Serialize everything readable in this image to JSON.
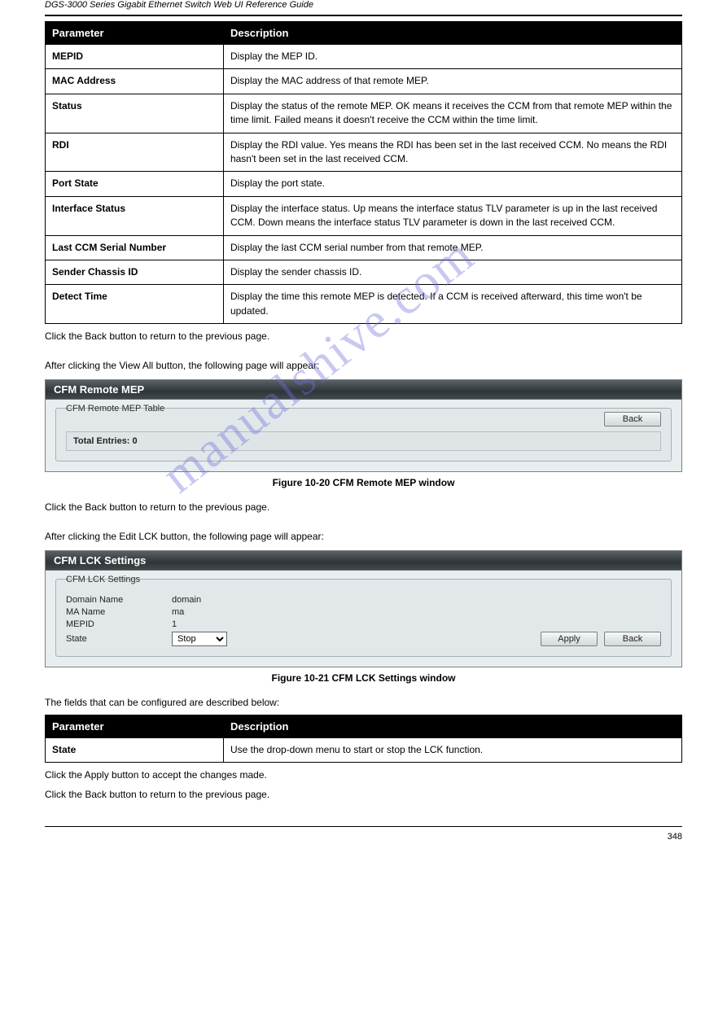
{
  "header": {
    "left": "DGS-3000 Series Gigabit Ethernet Switch Web UI Reference Guide",
    "right": ""
  },
  "watermark": "manualshive.com",
  "table1": {
    "headers": [
      "Parameter",
      "Description"
    ],
    "rows": [
      {
        "k": "MEPID",
        "v": "Display the MEP ID."
      },
      {
        "k": "MAC Address",
        "v": "Display the MAC address of that remote MEP."
      },
      {
        "k": "Status",
        "v": "Display the status of the remote MEP. OK means it receives the CCM from that remote MEP within the time limit. Failed means it doesn't receive the CCM within the time limit."
      },
      {
        "k": "RDI",
        "v": "Display the RDI value. Yes means the RDI has been set in the last received CCM. No means the RDI hasn't been set in the last received CCM."
      },
      {
        "k": "Port State",
        "v": "Display the port state."
      },
      {
        "k": "Interface Status",
        "v": "Display the interface status. Up means the interface status TLV parameter is up in the last received CCM. Down means the interface status TLV parameter is down in the last received CCM."
      },
      {
        "k": "Last CCM Serial Number",
        "v": "Display the last CCM serial number from that remote MEP."
      },
      {
        "k": "Sender Chassis ID",
        "v": "Display the sender chassis ID."
      },
      {
        "k": "Detect Time",
        "v": "Display the time this remote MEP is detected. If a CCM is received afterward, this time won't be updated."
      }
    ]
  },
  "text_after_table1": "Click the Back button to return to the previous page.",
  "text_view_all": "After clicking the View All button, the following page will appear:",
  "panel1": {
    "title": "CFM Remote MEP",
    "legend": "CFM Remote MEP Table",
    "back": "Back",
    "total": "Total Entries: 0"
  },
  "figure1_caption": "Figure 10-20 CFM Remote MEP window",
  "text_back2": "Click the Back button to return to the previous page.",
  "text_edit_lck": "After clicking the Edit LCK button, the following page will appear:",
  "panel2": {
    "title": "CFM LCK Settings",
    "legend": "CFM LCK Settings",
    "rows": {
      "domain_label": "Domain Name",
      "domain_value": "domain",
      "ma_label": "MA Name",
      "ma_value": "ma",
      "mepid_label": "MEPID",
      "mepid_value": "1",
      "state_label": "State",
      "state_value": "Stop"
    },
    "apply": "Apply",
    "back": "Back"
  },
  "figure2_caption": "Figure 10-21 CFM LCK Settings window",
  "text_fields_described": "The fields that can be configured are described below:",
  "table2": {
    "headers": [
      "Parameter",
      "Description"
    ],
    "rows": [
      {
        "k": "State",
        "v": "Use the drop-down menu to start or stop the LCK function."
      }
    ]
  },
  "text_apply": "Click the Apply button to accept the changes made.",
  "text_back3": "Click the Back button to return to the previous page.",
  "footer": {
    "page": "348"
  }
}
